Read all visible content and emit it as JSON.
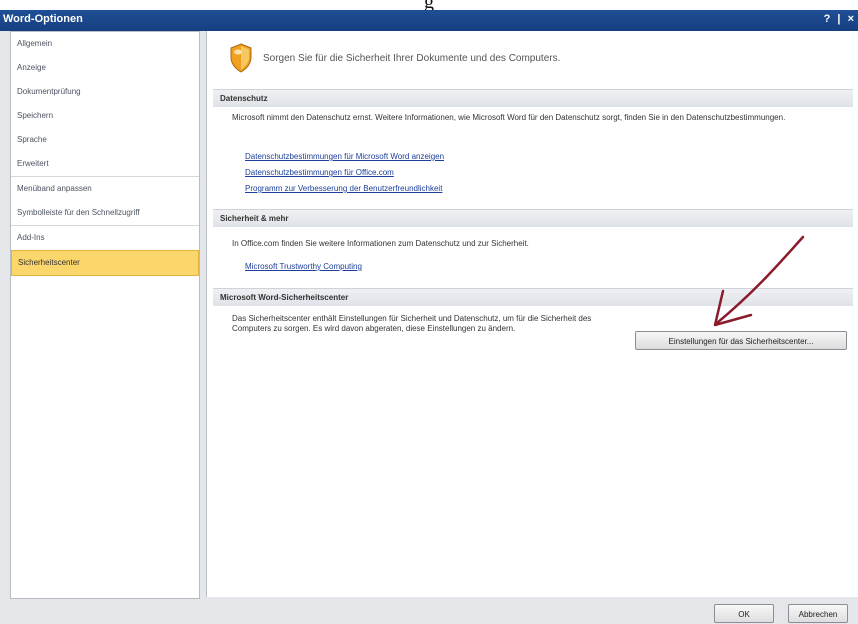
{
  "caption": "g",
  "window": {
    "title": "Word-Optionen",
    "title_buttons": "? | ×"
  },
  "sidebar": {
    "items": [
      {
        "label": "Allgemein"
      },
      {
        "label": "Anzeige"
      },
      {
        "label": "Dokumentprüfung"
      },
      {
        "label": "Speichern"
      },
      {
        "label": "Sprache"
      },
      {
        "label": "Erweitert"
      },
      {
        "label": "Menüband anpassen"
      },
      {
        "label": "Symbolleiste für den Schnellzugriff"
      },
      {
        "label": "Add-Ins"
      },
      {
        "label": "Sicherheitscenter"
      }
    ],
    "active_index": 9
  },
  "main": {
    "header_text": "Sorgen Sie für die Sicherheit Ihrer Dokumente und des Computers.",
    "privacy": {
      "heading": "Datenschutz",
      "description": "Microsoft nimmt den Datenschutz ernst. Weitere Informationen, wie Microsoft Word für den Datenschutz sorgt, finden Sie in den Datenschutzbestimmungen.",
      "links": [
        "Datenschutzbestimmungen für Microsoft Word anzeigen",
        "Datenschutzbestimmungen für Office.com",
        "Programm zur Verbesserung der Benutzerfreundlichkeit"
      ]
    },
    "security": {
      "heading": "Sicherheit & mehr",
      "description": "In Office.com finden Sie weitere Informationen zum Datenschutz und zur Sicherheit.",
      "link": "Microsoft Trustworthy Computing"
    },
    "trust_center": {
      "heading": "Microsoft Word-Sicherheitscenter",
      "description": "Das Sicherheitscenter enthält Einstellungen für Sicherheit und Datenschutz, um für die Sicherheit des Computers zu sorgen. Es wird davon abgeraten, diese Einstellungen zu ändern.",
      "button_label": "Einstellungen für das Sicherheitscenter..."
    }
  },
  "footer": {
    "ok_label": "OK",
    "cancel_label": "Abbrechen"
  },
  "colors": {
    "titlebar": "#1f4f96",
    "active_item": "#fbd66b",
    "link": "#1d3f9a",
    "annotation_arrow": "#8b1a2b"
  }
}
